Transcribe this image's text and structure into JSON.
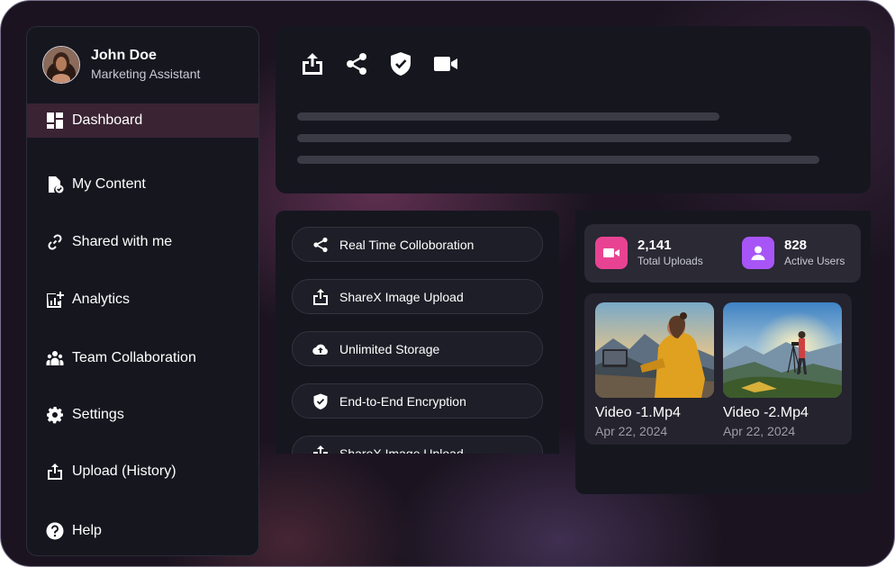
{
  "user": {
    "name": "John Doe",
    "role": "Marketing Assistant"
  },
  "sidebar": {
    "items": [
      {
        "label": "Dashboard",
        "icon": "dashboard-icon",
        "active": true
      },
      {
        "label": "My Content",
        "icon": "content-check-icon"
      },
      {
        "label": "Shared with me",
        "icon": "link-icon"
      },
      {
        "label": "Analytics",
        "icon": "analytics-icon"
      },
      {
        "label": "Team Collaboration",
        "icon": "team-icon"
      },
      {
        "label": "Settings",
        "icon": "gear-icon"
      },
      {
        "label": "Upload (History)",
        "icon": "upload-icon"
      },
      {
        "label": "Help",
        "icon": "help-icon"
      }
    ]
  },
  "toolbar": {
    "icons": [
      "upload-icon",
      "share-icon",
      "shield-check-icon",
      "video-camera-icon"
    ]
  },
  "features": {
    "items": [
      {
        "label": "Real Time Colloboration",
        "icon": "share-icon"
      },
      {
        "label": "ShareX Image Upload",
        "icon": "upload-icon"
      },
      {
        "label": "Unlimited Storage",
        "icon": "cloud-upload-icon"
      },
      {
        "label": "End-to-End Encryption",
        "icon": "shield-check-icon"
      },
      {
        "label": "ShareX Image Upload",
        "icon": "upload-icon"
      }
    ]
  },
  "stats": {
    "uploads": {
      "value": "2,141",
      "label": "Total Uploads",
      "color": "#e84393"
    },
    "users": {
      "value": "828",
      "label": "Active Users",
      "color": "#a855f7"
    }
  },
  "videos": [
    {
      "title": "Video -1.Mp4",
      "date": "Apr 22, 2024"
    },
    {
      "title": "Video -2.Mp4",
      "date": "Apr 22, 2024"
    }
  ],
  "colors": {
    "accent_active": "#3a2333",
    "panel": "#16161f",
    "background": "#1b1420"
  }
}
